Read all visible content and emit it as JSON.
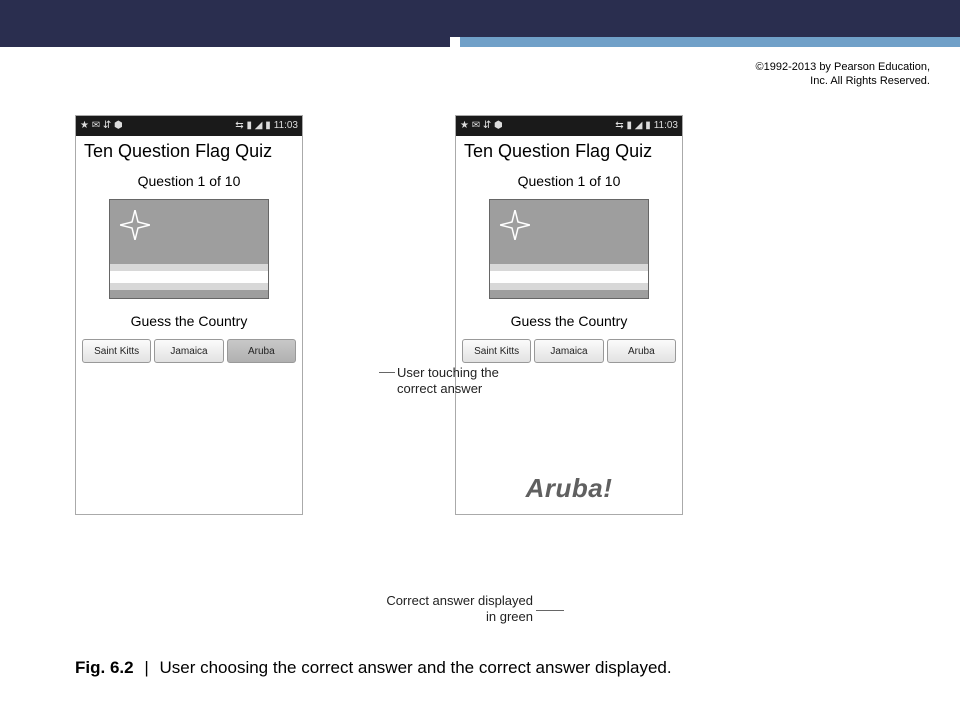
{
  "header": {
    "copyright": "©1992-2013 by Pearson Education, Inc. All Rights Reserved."
  },
  "status_bar": {
    "icons_left": "★ ✉ ⇵ ⬢",
    "icons_right": "⇆ ▮ ◢ ▮",
    "time": "11:03"
  },
  "app": {
    "title": "Ten Question Flag Quiz",
    "question_label": "Question 1 of 10",
    "guess_label": "Guess the Country",
    "answers": [
      "Saint Kitts",
      "Jamaica",
      "Aruba"
    ],
    "correct_result": "Aruba!"
  },
  "annotations": {
    "touching": "User touching the correct answer",
    "displayed": "Correct answer displayed in green"
  },
  "figure": {
    "label": "Fig. 6.2",
    "sep": "|",
    "caption": "User choosing the correct answer and the correct answer displayed."
  }
}
